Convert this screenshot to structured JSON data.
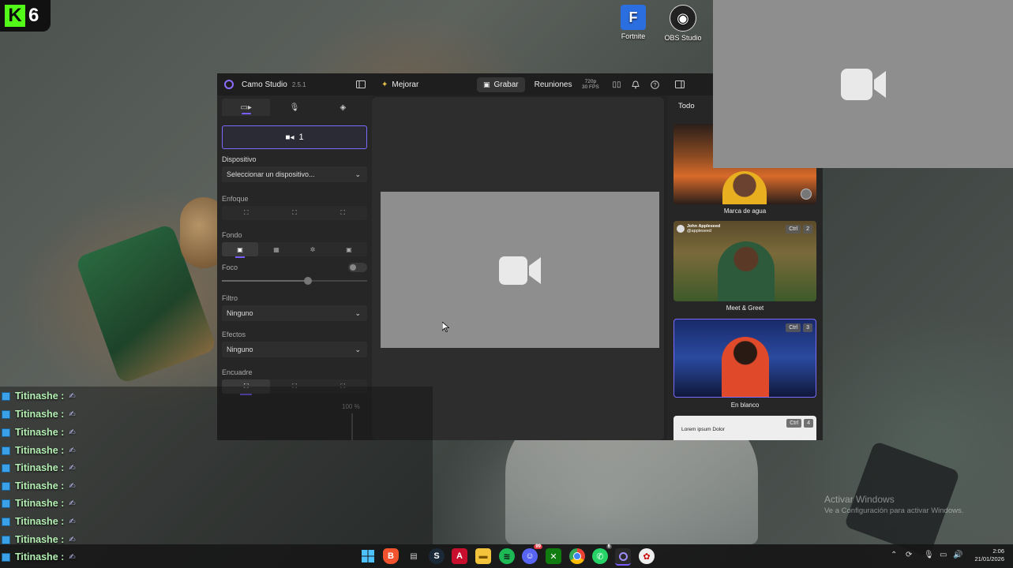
{
  "overlay": {
    "kick_number": "6"
  },
  "desktop_icons": [
    {
      "label": "Fortnite",
      "glyph": "F",
      "color": "#2a6ee0"
    },
    {
      "label": "OBS Studio",
      "glyph": "◉",
      "color": "#222222"
    }
  ],
  "camo": {
    "app_name": "Camo Studio",
    "version": "2.5.1",
    "enhance_label": "Mejorar",
    "record_label": "Grabar",
    "meetings_label": "Reuniones",
    "resolution": "720p",
    "fps": "30 FPS",
    "left_panel": {
      "camera_slot_label": "1",
      "device_label": "Dispositivo",
      "device_value": "Seleccionar un dispositivo...",
      "focus_label": "Enfoque",
      "background_label": "Fondo",
      "blur_label": "Foco",
      "filter_label": "Filtro",
      "filter_value": "Ninguno",
      "effects_label": "Efectos",
      "effects_value": "Ninguno",
      "framing_label": "Encuadre",
      "zoom_value": "100 %"
    },
    "scenes": {
      "filter_tab": "Todo",
      "items": [
        {
          "name": "Marca de agua"
        },
        {
          "name": "Meet & Greet",
          "ctrl": "Ctrl",
          "num": "2",
          "owner": "John Appleseed",
          "handle": "@appleseed"
        },
        {
          "name": "En blanco",
          "ctrl": "Ctrl",
          "num": "3"
        },
        {
          "name": "",
          "ctrl": "Ctrl",
          "num": "4",
          "text": "Lorem ipsum Dolor"
        }
      ]
    }
  },
  "chat": {
    "lines": [
      {
        "user": "Titinashe :"
      },
      {
        "user": "Titinashe :"
      },
      {
        "user": "Titinashe :"
      },
      {
        "user": "Titinashe :"
      },
      {
        "user": "Titinashe :"
      },
      {
        "user": "Titinashe :"
      },
      {
        "user": "Titinashe :"
      },
      {
        "user": "Titinashe :"
      },
      {
        "user": "Titinashe :"
      },
      {
        "user": "Titinashe :"
      }
    ]
  },
  "watermark": {
    "title": "Activar Windows",
    "subtitle": "Ve a Configuración para activar Windows."
  },
  "taskbar": {
    "apps": [
      "windows-start",
      "brave",
      "taskmgr",
      "steam",
      "adobe",
      "file-explorer",
      "spotify",
      "discord",
      "xbox",
      "chrome",
      "whatsapp",
      "camo",
      "game-app"
    ],
    "discord_badge": "99",
    "whatsapp_badge": "6",
    "time": "2:06",
    "date": "21/01/2026"
  }
}
